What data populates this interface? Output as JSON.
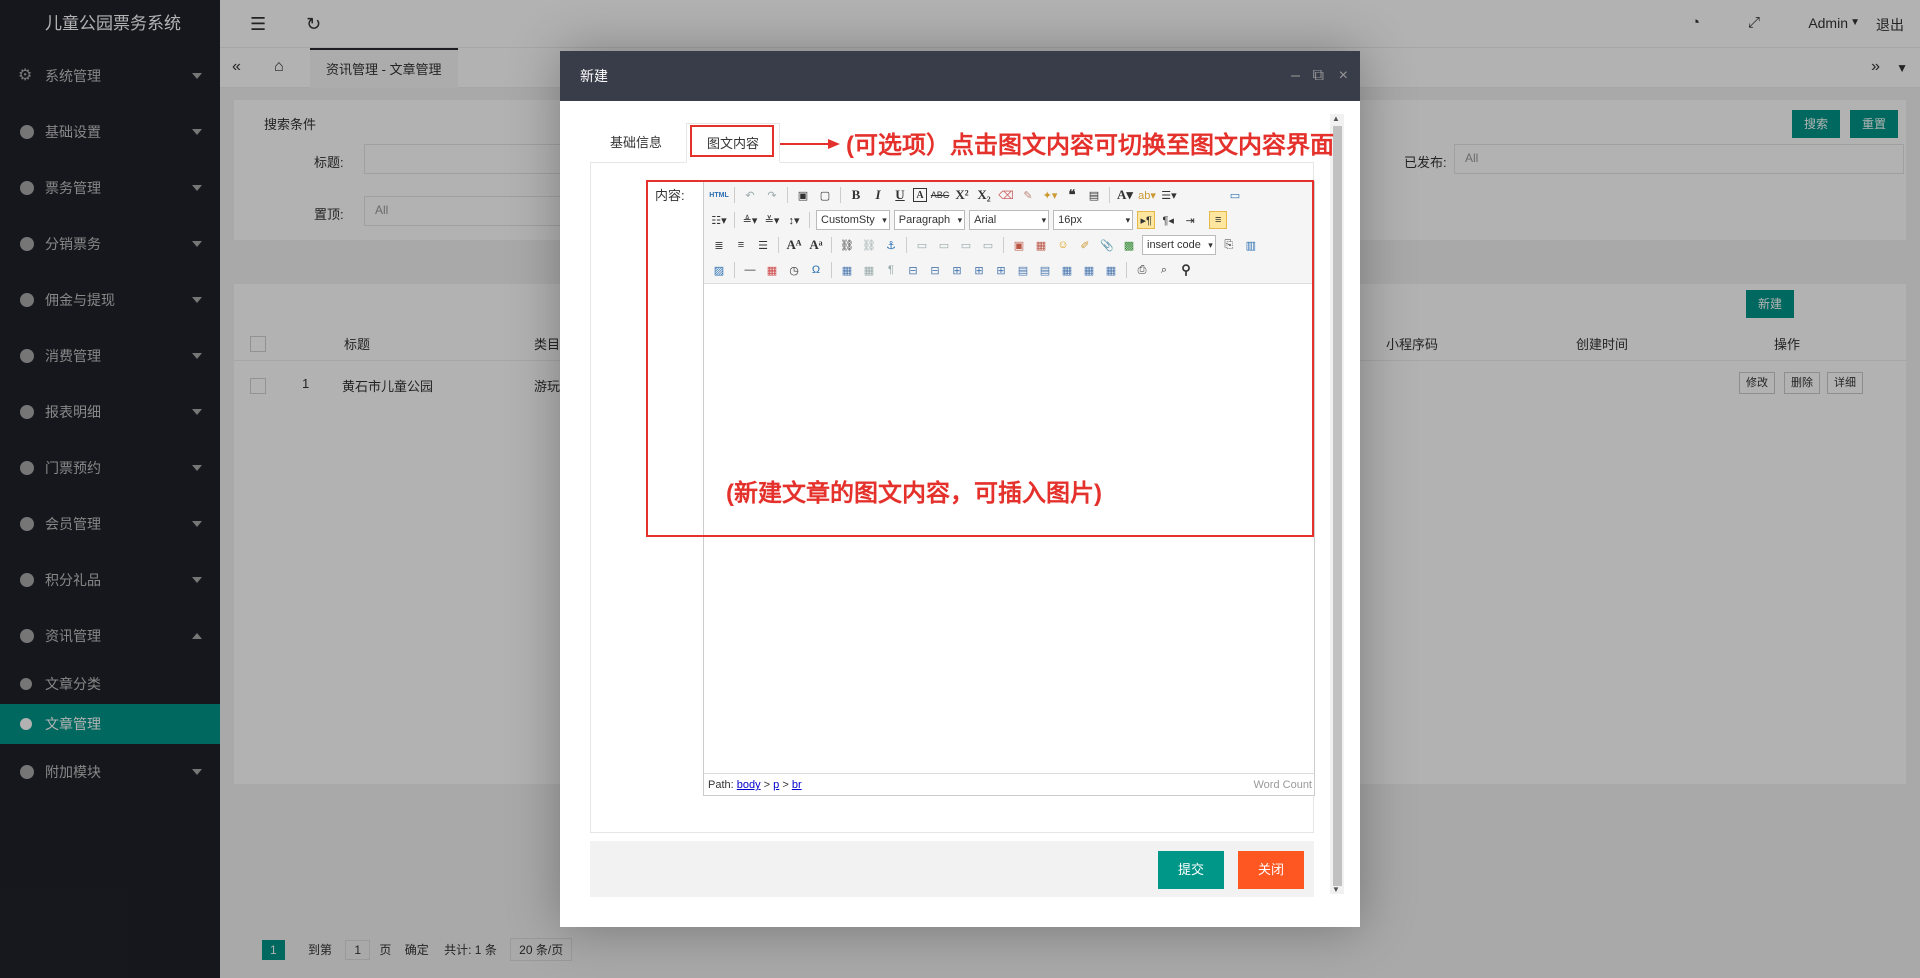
{
  "app": {
    "title": "儿童公园票务系统",
    "user": "Admin",
    "logout": "退出"
  },
  "sidebar": {
    "items": [
      {
        "label": "系统管理"
      },
      {
        "label": "基础设置"
      },
      {
        "label": "票务管理"
      },
      {
        "label": "分销票务"
      },
      {
        "label": "佣金与提现"
      },
      {
        "label": "消费管理"
      },
      {
        "label": "报表明细"
      },
      {
        "label": "门票预约"
      },
      {
        "label": "会员管理"
      },
      {
        "label": "积分礼品"
      },
      {
        "label": "资讯管理"
      },
      {
        "label": "附加模块"
      }
    ],
    "sub_items": [
      {
        "label": "文章分类"
      },
      {
        "label": "文章管理"
      }
    ]
  },
  "tabs_bar": {
    "active_tab": "资讯管理 - 文章管理"
  },
  "search": {
    "title": "搜索条件",
    "title_label": "标题:",
    "published_label": "已发布:",
    "published_value": "All",
    "top_label": "置顶:",
    "top_value": "All",
    "search_btn": "搜索",
    "reset_btn": "重置"
  },
  "table": {
    "new_btn": "新建",
    "headers": [
      "标题",
      "类目",
      "小程序码",
      "创建时间",
      "操作"
    ],
    "rows": [
      {
        "index": "1",
        "title": "黄石市儿童公园",
        "category": "游玩"
      }
    ],
    "row_actions": [
      "修改",
      "删除",
      "详细"
    ]
  },
  "pager": {
    "page": "1",
    "goto": "到第",
    "goto_value": "1",
    "page_unit": "页",
    "confirm": "确定",
    "total": "共计: 1 条",
    "per_page": "20 条/页"
  },
  "modal": {
    "title": "新建",
    "tabs": [
      "基础信息",
      "图文内容"
    ],
    "content_label": "内容:",
    "toolbar": {
      "style_select": "CustomSty",
      "format_select": "Paragraph",
      "font_select": "Arial",
      "size_select": "16px",
      "code_select": "insert code"
    },
    "path": {
      "prefix": "Path:",
      "body": "body",
      "p": "p",
      "br": "br",
      "sep": ">",
      "word_count": "Word Count"
    },
    "submit": "提交",
    "close": "关闭"
  },
  "annotations": {
    "tab_hint": "(可选项）点击图文内容可切换至图文内容界面",
    "editor_hint": "(新建文章的图文内容，可插入图片)"
  },
  "colors": {
    "accent": "#009688",
    "danger": "#ff5722",
    "annotation": "#e5312c"
  }
}
